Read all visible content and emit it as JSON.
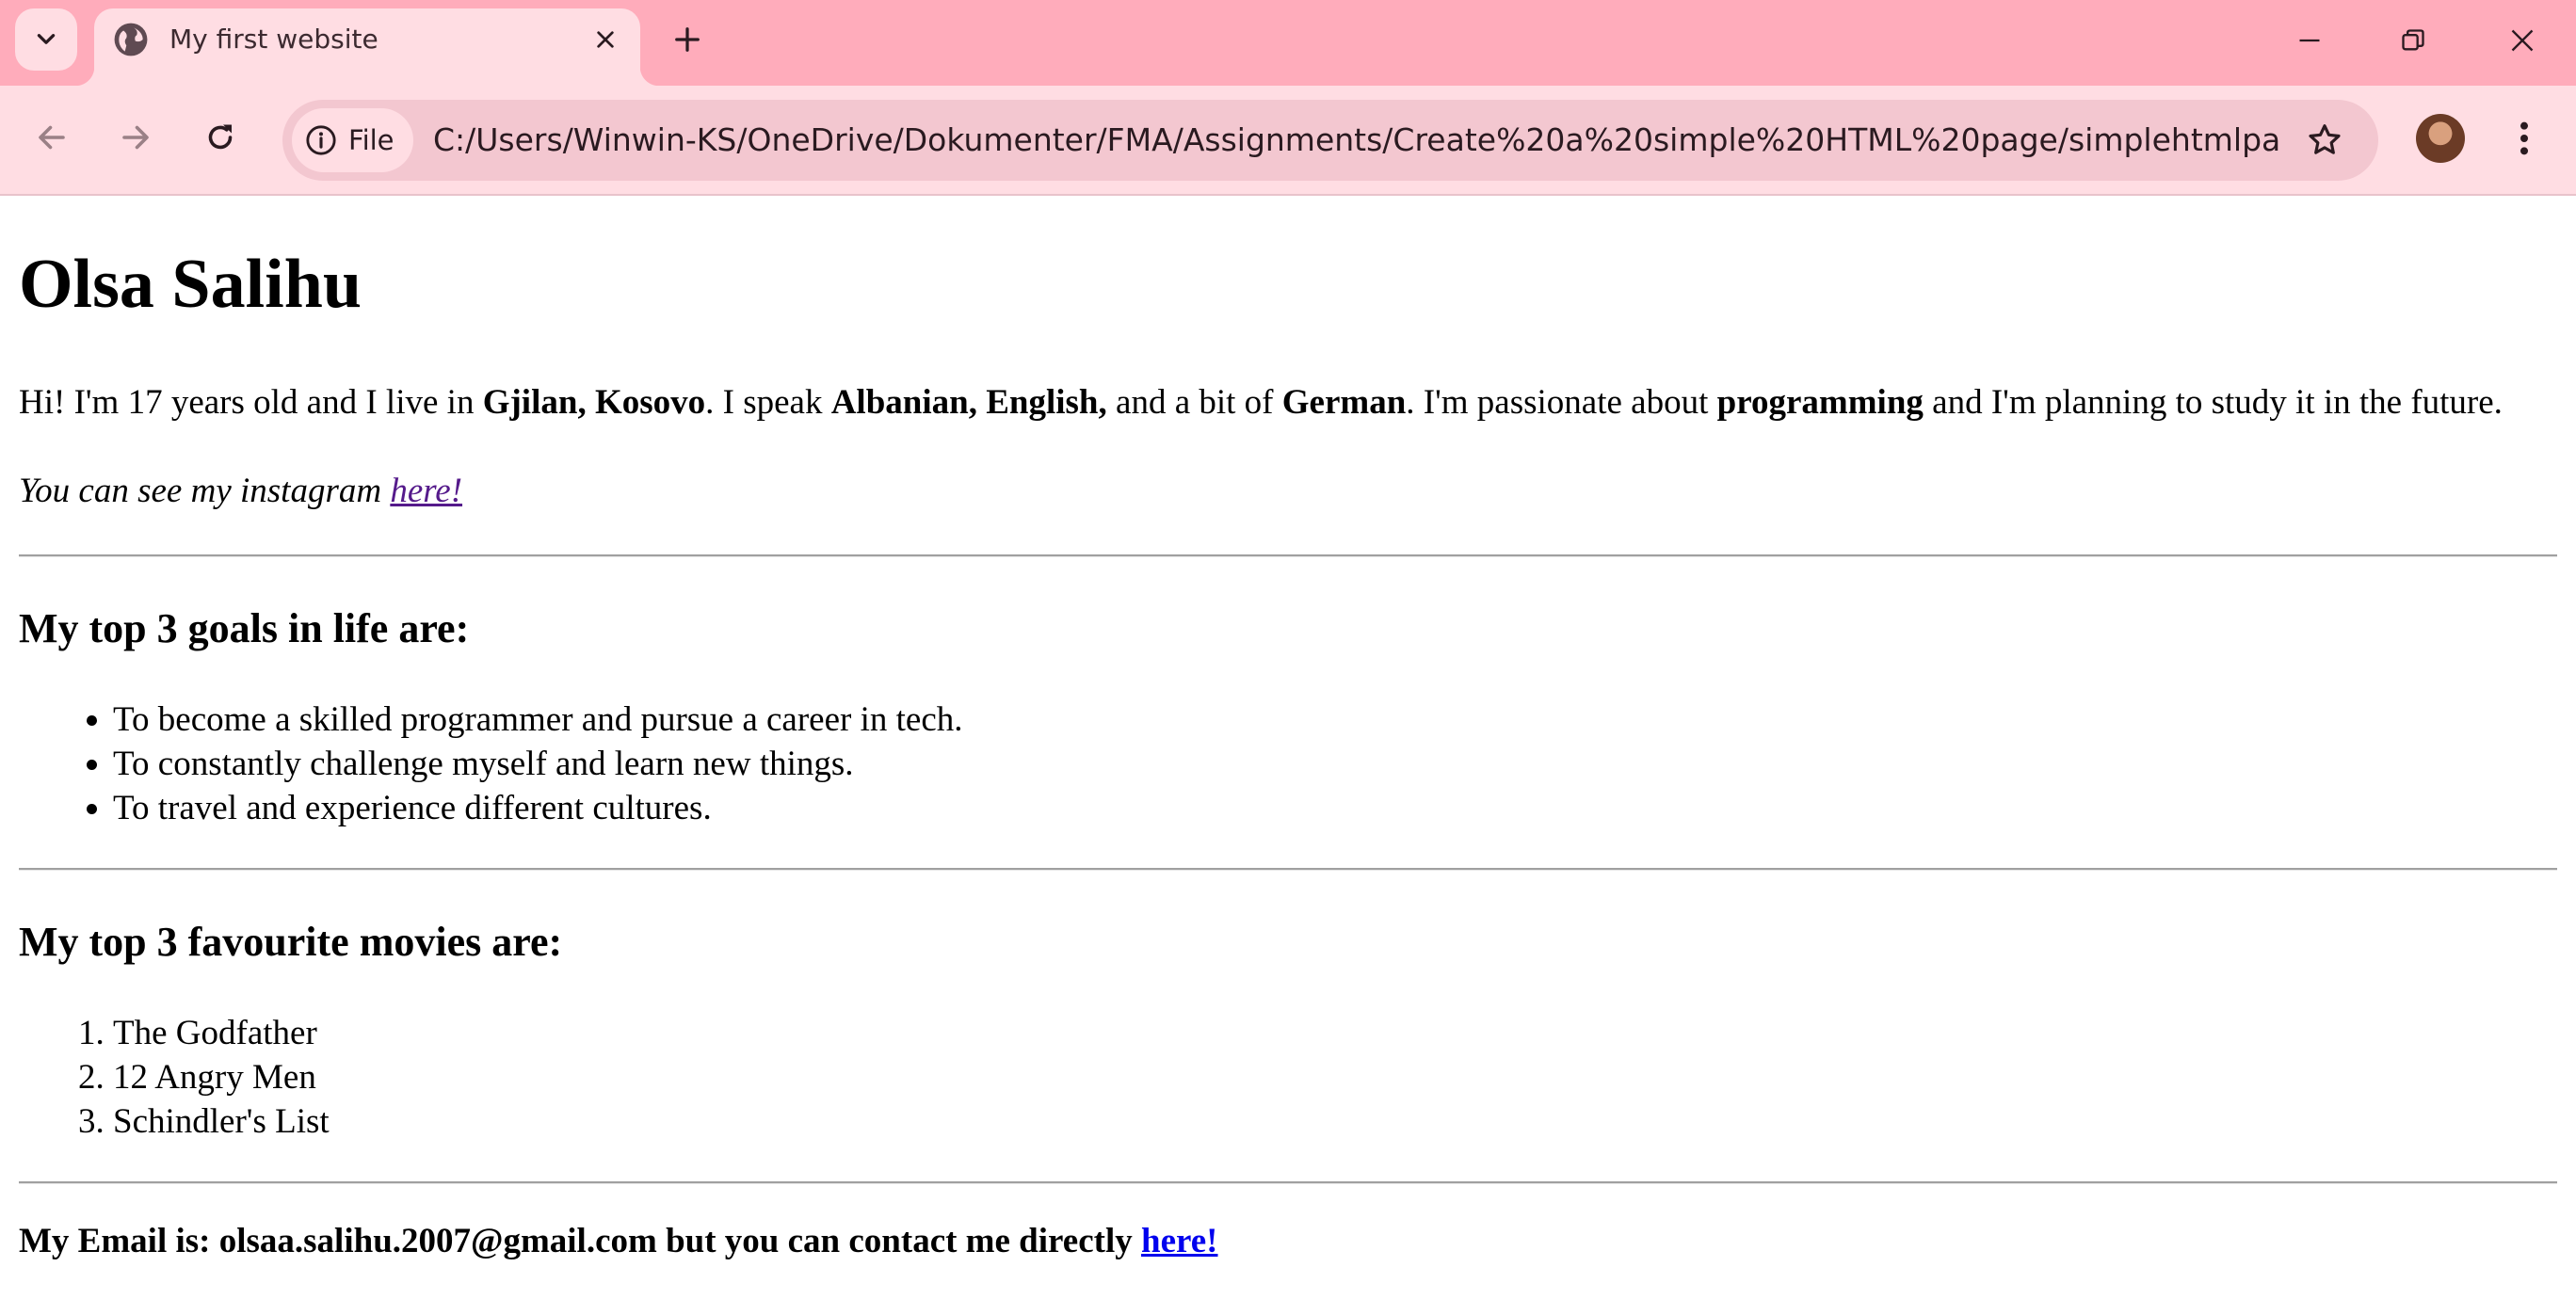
{
  "browser": {
    "tab": {
      "title": "My first website"
    },
    "address_bar": {
      "chip_label": "File",
      "url": "C:/Users/Winwin-KS/OneDrive/Dokumenter/FMA/Assignments/Create%20a%20simple%20HTML%20page/simplehtmlpage.h..."
    },
    "colors": {
      "tabbar_bg": "#ffacbb",
      "toolbar_bg": "#ffdde3"
    },
    "icons": {
      "tab_search": "chevron-down-icon",
      "favicon": "globe-icon",
      "tab_close": "close-icon",
      "new_tab": "plus-icon",
      "minimize": "minimize-icon",
      "restore": "restore-icon",
      "close": "close-icon",
      "back": "arrow-left-icon",
      "forward": "arrow-right-icon",
      "reload": "reload-icon",
      "site_info": "info-icon",
      "bookmark": "star-icon",
      "profile": "avatar",
      "menu": "kebab-menu-icon"
    }
  },
  "page": {
    "title": "Olsa Salihu",
    "intro": {
      "part1": "Hi! I'm 17 years old and I live in ",
      "location": "Gjilan, Kosovo",
      "part2": ". I speak ",
      "languages": "Albanian, English,",
      "part3": " and a bit of ",
      "extra_language": "German",
      "part4": ". I'm passionate about ",
      "passion": "programming",
      "part5": " and I'm planning to study it in the future."
    },
    "instagram": {
      "text": "You can see my instagram ",
      "link_label": "here!"
    },
    "goals": {
      "heading": "My top 3 goals in life are:",
      "items": [
        "To become a skilled programmer and pursue a career in tech.",
        "To constantly challenge myself and learn new things.",
        "To travel and experience different cultures."
      ]
    },
    "movies": {
      "heading": "My top 3 favourite movies are:",
      "items": [
        "The Godfather",
        "12 Angry Men",
        "Schindler's List"
      ]
    },
    "contact": {
      "text": "My Email is: olsaa.salihu.2007@gmail.com but you can contact me directly ",
      "link_label": "here!"
    }
  }
}
